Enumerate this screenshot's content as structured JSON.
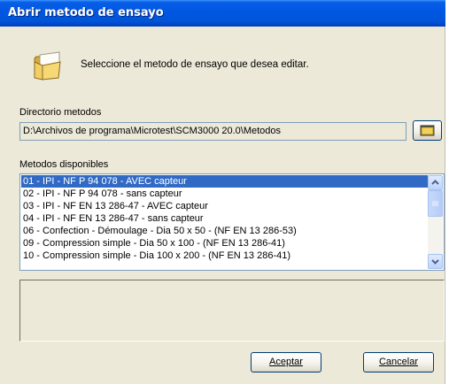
{
  "window": {
    "title": "Abrir metodo de ensayo"
  },
  "header": {
    "instruction": "Seleccione el metodo de ensayo que desea editar."
  },
  "directory": {
    "label": "Directorio metodos",
    "path": "D:\\Archivos de programa\\Microtest\\SCM3000 20.0\\Metodos"
  },
  "methods": {
    "label": "Metodos disponibles",
    "items": [
      "01 - IPI - NF P 94 078 - AVEC capteur",
      "02 - IPI - NF P 94 078 - sans capteur",
      "03 - IPI - NF EN 13 286-47 - AVEC capteur",
      "04 - IPI - NF EN 13 286-47 - sans capteur",
      "06 - Confection - Démoulage - Dia 50 x 50 - (NF EN 13 286-53)",
      "09 - Compression simple - Dia 50 x 100 - (NF EN 13 286-41)",
      "10 - Compression simple - Dia 100 x 200 - (NF EN 13 286-41)"
    ],
    "selected_index": 0
  },
  "buttons": {
    "accept": "Aceptar",
    "cancel": "Cancelar"
  },
  "icons": {
    "folder": "folder-icon",
    "browse": "folder-browse-icon"
  },
  "colors": {
    "titlebar": "#0054e3",
    "selection": "#316ac5",
    "dialog_bg": "#ece9d8"
  }
}
